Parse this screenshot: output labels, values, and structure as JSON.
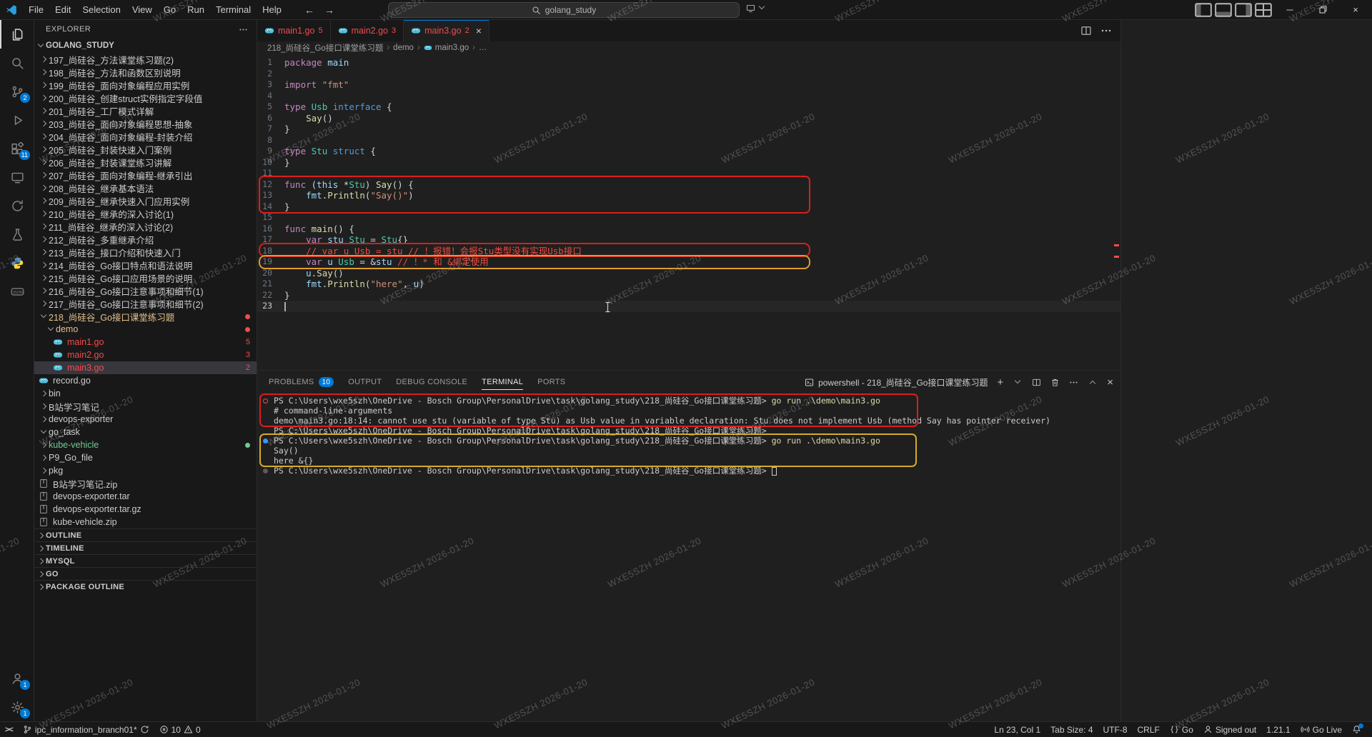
{
  "watermark": {
    "text": "WXE5SZH  2026-01-20"
  },
  "titlebar": {
    "menus": [
      "File",
      "Edit",
      "Selection",
      "View",
      "Go",
      "Run",
      "Terminal",
      "Help"
    ],
    "search_value": "golang_study"
  },
  "activity_bar": {
    "top": [
      {
        "icon": "explorer",
        "active": true
      },
      {
        "icon": "search"
      },
      {
        "icon": "source-control",
        "badge": "2"
      },
      {
        "icon": "run-debug"
      },
      {
        "icon": "extensions",
        "badge": "11"
      },
      {
        "icon": "remote"
      },
      {
        "icon": "sync"
      },
      {
        "icon": "testing"
      },
      {
        "icon": "python"
      },
      {
        "icon": "json"
      }
    ],
    "bottom": [
      {
        "icon": "account",
        "badge": "1"
      },
      {
        "icon": "settings",
        "badge": "1"
      }
    ]
  },
  "sidebar": {
    "title": "EXPLORER",
    "root": "GOLANG_STUDY",
    "items": [
      {
        "label": "197_尚硅谷_方法课堂练习题(2)",
        "kind": "folder",
        "depth": 1
      },
      {
        "label": "198_尚硅谷_方法和函数区别说明",
        "kind": "folder",
        "depth": 1
      },
      {
        "label": "199_尚硅谷_面向对象编程应用实例",
        "kind": "folder",
        "depth": 1
      },
      {
        "label": "200_尚硅谷_创建struct实例指定字段值",
        "kind": "folder",
        "depth": 1
      },
      {
        "label": "201_尚硅谷_工厂模式详解",
        "kind": "folder",
        "depth": 1
      },
      {
        "label": "203_尚硅谷_面向对象编程思想-抽象",
        "kind": "folder",
        "depth": 1
      },
      {
        "label": "204_尚硅谷_面向对象编程-封装介绍",
        "kind": "folder",
        "depth": 1
      },
      {
        "label": "205_尚硅谷_封装快速入门案例",
        "kind": "folder",
        "depth": 1
      },
      {
        "label": "206_尚硅谷_封装课堂练习讲解",
        "kind": "folder",
        "depth": 1
      },
      {
        "label": "207_尚硅谷_面向对象编程-继承引出",
        "kind": "folder",
        "depth": 1
      },
      {
        "label": "208_尚硅谷_继承基本语法",
        "kind": "folder",
        "depth": 1
      },
      {
        "label": "209_尚硅谷_继承快速入门应用实例",
        "kind": "folder",
        "depth": 1
      },
      {
        "label": "210_尚硅谷_继承的深入讨论(1)",
        "kind": "folder",
        "depth": 1
      },
      {
        "label": "211_尚硅谷_继承的深入讨论(2)",
        "kind": "folder",
        "depth": 1
      },
      {
        "label": "212_尚硅谷_多重继承介绍",
        "kind": "folder",
        "depth": 1
      },
      {
        "label": "213_尚硅谷_接口介绍和快速入门",
        "kind": "folder",
        "depth": 1
      },
      {
        "label": "214_尚硅谷_Go接口特点和语法说明",
        "kind": "folder",
        "depth": 1
      },
      {
        "label": "215_尚硅谷_Go接口应用场景的说明",
        "kind": "folder",
        "depth": 1
      },
      {
        "label": "216_尚硅谷_Go接口注意事项和细节(1)",
        "kind": "folder",
        "depth": 1
      },
      {
        "label": "217_尚硅谷_Go接口注意事项和细节(2)",
        "kind": "folder",
        "depth": 1
      },
      {
        "label": "218_尚硅谷_Go接口课堂练习题",
        "kind": "folder-open",
        "depth": 1,
        "color": "modified",
        "dot": "red"
      },
      {
        "label": "demo",
        "kind": "folder-open",
        "depth": 2,
        "color": "modified",
        "dot": "red"
      },
      {
        "label": "main1.go",
        "kind": "go",
        "depth": 3,
        "color": "error",
        "badge": "5"
      },
      {
        "label": "main2.go",
        "kind": "go",
        "depth": 3,
        "color": "error",
        "badge": "3"
      },
      {
        "label": "main3.go",
        "kind": "go",
        "depth": 3,
        "color": "error",
        "badge": "2",
        "selected": true
      },
      {
        "label": "record.go",
        "kind": "go",
        "depth": 1
      },
      {
        "label": "bin",
        "kind": "folder",
        "depth": 1
      },
      {
        "label": "B站学习笔记",
        "kind": "folder",
        "depth": 1
      },
      {
        "label": "devops-exporter",
        "kind": "folder",
        "depth": 1
      },
      {
        "label": "go_task",
        "kind": "folder-open",
        "depth": 1
      },
      {
        "label": "kube-vehicle",
        "kind": "folder",
        "depth": 1,
        "color": "added",
        "dot": "green"
      },
      {
        "label": "P9_Go_file",
        "kind": "folder",
        "depth": 1
      },
      {
        "label": "pkg",
        "kind": "folder",
        "depth": 1
      },
      {
        "label": "B站学习笔记.zip",
        "kind": "zip",
        "depth": 1
      },
      {
        "label": "devops-exporter.tar",
        "kind": "zip",
        "depth": 1
      },
      {
        "label": "devops-exporter.tar.gz",
        "kind": "zip",
        "depth": 1
      },
      {
        "label": "kube-vehicle.zip",
        "kind": "zip",
        "depth": 1
      }
    ],
    "sections": [
      "OUTLINE",
      "TIMELINE",
      "MYSQL",
      "GO",
      "PACKAGE OUTLINE"
    ]
  },
  "editor": {
    "tabs": [
      {
        "label": "main1.go",
        "badge": "5"
      },
      {
        "label": "main2.go",
        "badge": "3"
      },
      {
        "label": "main3.go",
        "badge": "2",
        "active": true
      }
    ],
    "breadcrumb": [
      "218_尚硅谷_Go接口课堂练习题",
      "demo",
      "main3.go",
      "…"
    ],
    "lines": [
      {
        "n": 1,
        "t": [
          [
            "k",
            "package"
          ],
          [
            "p",
            " "
          ],
          [
            "v",
            "main"
          ]
        ]
      },
      {
        "n": 2,
        "t": []
      },
      {
        "n": 3,
        "t": [
          [
            "k",
            "import"
          ],
          [
            "p",
            " "
          ],
          [
            "s",
            "\"fmt\""
          ]
        ]
      },
      {
        "n": 4,
        "t": []
      },
      {
        "n": 5,
        "t": [
          [
            "k",
            "type"
          ],
          [
            "p",
            " "
          ],
          [
            "ty",
            "Usb"
          ],
          [
            "p",
            " "
          ],
          [
            "k2",
            "interface"
          ],
          [
            "p",
            " {"
          ]
        ]
      },
      {
        "n": 6,
        "t": [
          [
            "p",
            "    "
          ],
          [
            "f",
            "Say"
          ],
          [
            "p",
            "()"
          ]
        ]
      },
      {
        "n": 7,
        "t": [
          [
            "p",
            "}"
          ]
        ]
      },
      {
        "n": 8,
        "t": []
      },
      {
        "n": 9,
        "t": [
          [
            "k",
            "type"
          ],
          [
            "p",
            " "
          ],
          [
            "ty",
            "Stu"
          ],
          [
            "p",
            " "
          ],
          [
            "k2",
            "struct"
          ],
          [
            "p",
            " {"
          ]
        ]
      },
      {
        "n": 10,
        "t": [
          [
            "p",
            "}"
          ]
        ]
      },
      {
        "n": 11,
        "t": []
      },
      {
        "n": 12,
        "t": [
          [
            "k",
            "func"
          ],
          [
            "p",
            " ("
          ],
          [
            "v",
            "this"
          ],
          [
            "p",
            " *"
          ],
          [
            "ty",
            "Stu"
          ],
          [
            "p",
            ") "
          ],
          [
            "f",
            "Say"
          ],
          [
            "p",
            "() {"
          ]
        ]
      },
      {
        "n": 13,
        "t": [
          [
            "p",
            "    "
          ],
          [
            "v",
            "fmt"
          ],
          [
            "p",
            "."
          ],
          [
            "f",
            "Println"
          ],
          [
            "p",
            "("
          ],
          [
            "s",
            "\"Say()\""
          ],
          [
            "p",
            ")"
          ]
        ]
      },
      {
        "n": 14,
        "t": [
          [
            "p",
            "}"
          ]
        ]
      },
      {
        "n": 15,
        "t": []
      },
      {
        "n": 16,
        "t": [
          [
            "k",
            "func"
          ],
          [
            "p",
            " "
          ],
          [
            "f",
            "main"
          ],
          [
            "p",
            "() {"
          ]
        ]
      },
      {
        "n": 17,
        "t": [
          [
            "p",
            "    "
          ],
          [
            "k",
            "var"
          ],
          [
            "p",
            " "
          ],
          [
            "v",
            "stu"
          ],
          [
            "p",
            " "
          ],
          [
            "ty",
            "Stu"
          ],
          [
            "p",
            " = "
          ],
          [
            "ty",
            "Stu"
          ],
          [
            "p",
            "{}"
          ]
        ]
      },
      {
        "n": 18,
        "t": [
          [
            "p",
            "    "
          ],
          [
            "c",
            "// var u Usb = stu // ！报错！会报Stu类型没有实现Usb接口"
          ]
        ]
      },
      {
        "n": 19,
        "t": [
          [
            "p",
            "    "
          ],
          [
            "k",
            "var"
          ],
          [
            "p",
            " "
          ],
          [
            "v",
            "u"
          ],
          [
            "p",
            " "
          ],
          [
            "ty",
            "Usb"
          ],
          [
            "p",
            " = &"
          ],
          [
            "v",
            "stu"
          ],
          [
            "p",
            " "
          ],
          [
            "c",
            "// ！* 和 &绑定使用"
          ]
        ]
      },
      {
        "n": 20,
        "t": [
          [
            "p",
            "    "
          ],
          [
            "v",
            "u"
          ],
          [
            "p",
            "."
          ],
          [
            "f",
            "Say"
          ],
          [
            "p",
            "()"
          ]
        ]
      },
      {
        "n": 21,
        "t": [
          [
            "p",
            "    "
          ],
          [
            "v",
            "fmt"
          ],
          [
            "p",
            "."
          ],
          [
            "f",
            "Println"
          ],
          [
            "p",
            "("
          ],
          [
            "s",
            "\"here\""
          ],
          [
            "p",
            ", "
          ],
          [
            "v",
            "u"
          ],
          [
            "p",
            ")"
          ]
        ]
      },
      {
        "n": 22,
        "t": [
          [
            "p",
            "}"
          ]
        ]
      },
      {
        "n": 23,
        "t": [],
        "cursor": true
      }
    ]
  },
  "panel": {
    "tabs": [
      {
        "label": "PROBLEMS",
        "badge": "10"
      },
      {
        "label": "OUTPUT"
      },
      {
        "label": "DEBUG CONSOLE"
      },
      {
        "label": "TERMINAL",
        "active": true
      },
      {
        "label": "PORTS"
      }
    ],
    "terminal_label": "powershell - 218_尚硅谷_Go接口课堂练习题",
    "lines": [
      {
        "deco": "error",
        "t": [
          [
            "pr",
            "PS C:\\Users\\wxe5szh\\OneDrive - Bosch Group\\PersonalDrive\\task\\golang_study\\218_尚硅谷_Go接口课堂练习题>"
          ],
          [
            "cmd",
            " go run .\\demo\\main3.go"
          ]
        ]
      },
      {
        "t": [
          [
            "out",
            "# command-line-arguments"
          ]
        ]
      },
      {
        "t": [
          [
            "out",
            "demo\\main3.go:18:14: cannot use stu (variable of type Stu) as Usb value in variable declaration: Stu does not implement Usb (method Say has pointer receiver)"
          ]
        ]
      },
      {
        "t": [
          [
            "pr",
            "PS C:\\Users\\wxe5szh\\OneDrive - Bosch Group\\PersonalDrive\\task\\golang_study\\218_尚硅谷_Go接口课堂练习题>"
          ]
        ]
      },
      {
        "deco": "success",
        "t": [
          [
            "pr",
            "PS C:\\Users\\wxe5szh\\OneDrive - Bosch Group\\PersonalDrive\\task\\golang_study\\218_尚硅谷_Go接口课堂练习题>"
          ],
          [
            "cmd",
            " go run .\\demo\\main3.go"
          ]
        ]
      },
      {
        "t": [
          [
            "out",
            "Say()"
          ]
        ]
      },
      {
        "t": [
          [
            "out",
            "here &{}"
          ]
        ]
      },
      {
        "deco": "idle",
        "t": [
          [
            "pr",
            "PS C:\\Users\\wxe5szh\\OneDrive - Bosch Group\\PersonalDrive\\task\\golang_study\\218_尚硅谷_Go接口课堂练习题> "
          ]
        ],
        "cursor": true
      }
    ]
  },
  "statusbar": {
    "branch": "ipc_information_branch01*",
    "errors": "10",
    "warnings": "0",
    "line_col": "Ln 23, Col 1",
    "tab_size": "Tab Size: 4",
    "encoding": "UTF-8",
    "eol": "CRLF",
    "language": "Go",
    "account": "Signed out",
    "version": "1.21.1",
    "live": "Go Live"
  }
}
